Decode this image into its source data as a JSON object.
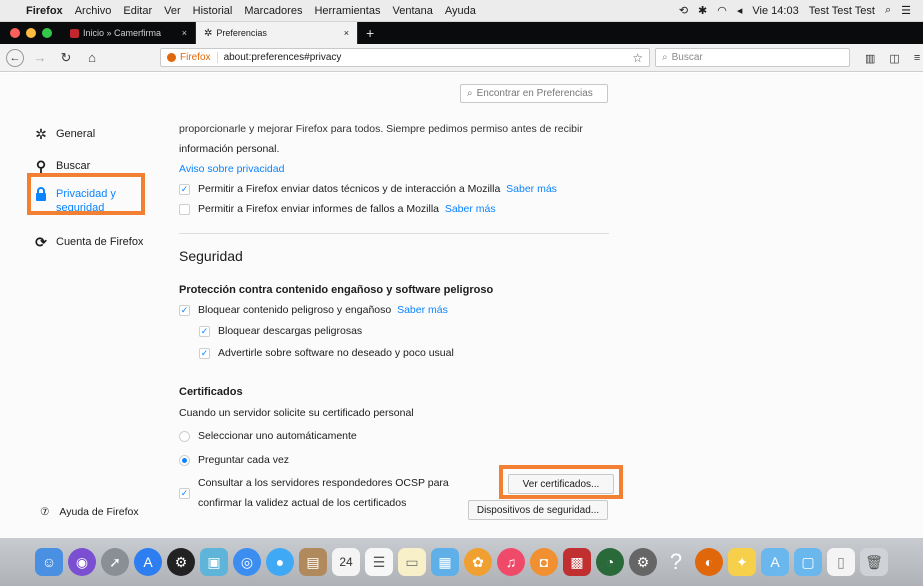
{
  "menubar": {
    "apple": "",
    "items": [
      "Firefox",
      "Archivo",
      "Editar",
      "Ver",
      "Historial",
      "Marcadores",
      "Herramientas",
      "Ventana",
      "Ayuda"
    ],
    "clock": "Vie 14:03",
    "user": "Test Test Test"
  },
  "tabs": [
    {
      "title": "Inicio » Camerfirma",
      "close": "×"
    },
    {
      "title": "Preferencias",
      "close": "×"
    }
  ],
  "new_tab": "+",
  "nav": {
    "url_identity": "Firefox",
    "url": "about:preferences#privacy",
    "search_placeholder": "Buscar"
  },
  "find_placeholder": "Encontrar en Preferencias",
  "sidebar": {
    "items": [
      {
        "label": "General",
        "icon": "gear-icon"
      },
      {
        "label": "Buscar",
        "icon": "search-icon"
      },
      {
        "label1": "Privacidad y",
        "label2": "seguridad",
        "icon": "lock-icon"
      },
      {
        "label": "Cuenta de Firefox",
        "icon": "sync-icon"
      }
    ],
    "help": "Ayuda de Firefox"
  },
  "main": {
    "partial_line": "proporcionarle y mejorar Firefox para todos. Siempre pedimos permiso antes de recibir",
    "info_personal": "información personal.",
    "privacy_notice": "Aviso sobre privacidad",
    "telemetry": "Permitir a Firefox enviar datos técnicos y de interacción a Mozilla",
    "crash": "Permitir a Firefox enviar informes de fallos a Mozilla",
    "learn_more": "Saber más",
    "security_title": "Seguridad",
    "phishing_title": "Protección contra contenido engañoso y software peligroso",
    "block_dangerous": "Bloquear contenido peligroso y engañoso",
    "block_downloads": "Bloquear descargas peligrosas",
    "warn_unwanted": "Advertirle sobre software no deseado y poco usual",
    "certs_title": "Certificados",
    "certs_when": "Cuando un servidor solicite su certificado personal",
    "select_auto": "Seleccionar uno automáticamente",
    "ask_every": "Preguntar cada vez",
    "ocsp_1": "Consultar a los servidores respondedores OCSP para",
    "ocsp_2": "confirmar la validez actual de los certificados",
    "view_certs": "Ver certificados...",
    "security_devices": "Dispositivos de seguridad..."
  },
  "colors": {
    "accent": "#0a84ff",
    "highlight": "#f37f33",
    "firefox_orange": "#e0670a"
  },
  "dock_calendar_day": "24"
}
